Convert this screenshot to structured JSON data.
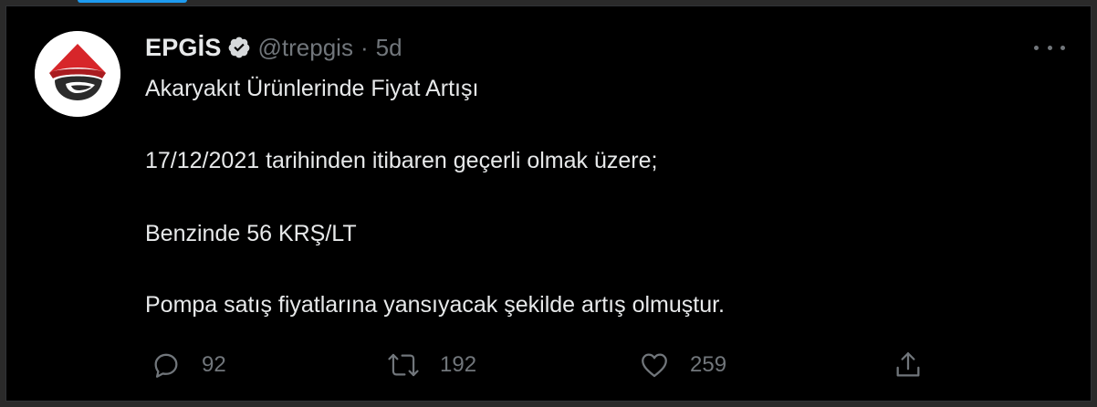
{
  "tweet": {
    "author_name": "EPGİS",
    "handle": "@trepgis",
    "separator": "·",
    "time": "5d",
    "lines": [
      "Akaryakıt Ürünlerinde Fiyat Artışı",
      "17/12/2021 tarihinden itibaren geçerli olmak üzere;",
      "Benzinde 56 KRŞ/LT",
      "Pompa satış fiyatlarına yansıyacak şekilde artış olmuştur."
    ]
  },
  "actions": {
    "reply_count": "92",
    "retweet_count": "192",
    "like_count": "259"
  },
  "icons": {
    "verified": "verified-badge-icon",
    "more": "more-options-icon",
    "reply": "reply-icon",
    "retweet": "retweet-icon",
    "like": "heart-icon",
    "share": "share-icon"
  },
  "colors": {
    "background": "#000000",
    "text": "#e7e9ea",
    "muted": "#71767b",
    "accent": "#1d9bf0",
    "logo_red": "#d7262a",
    "logo_dark": "#2b2b2b"
  }
}
